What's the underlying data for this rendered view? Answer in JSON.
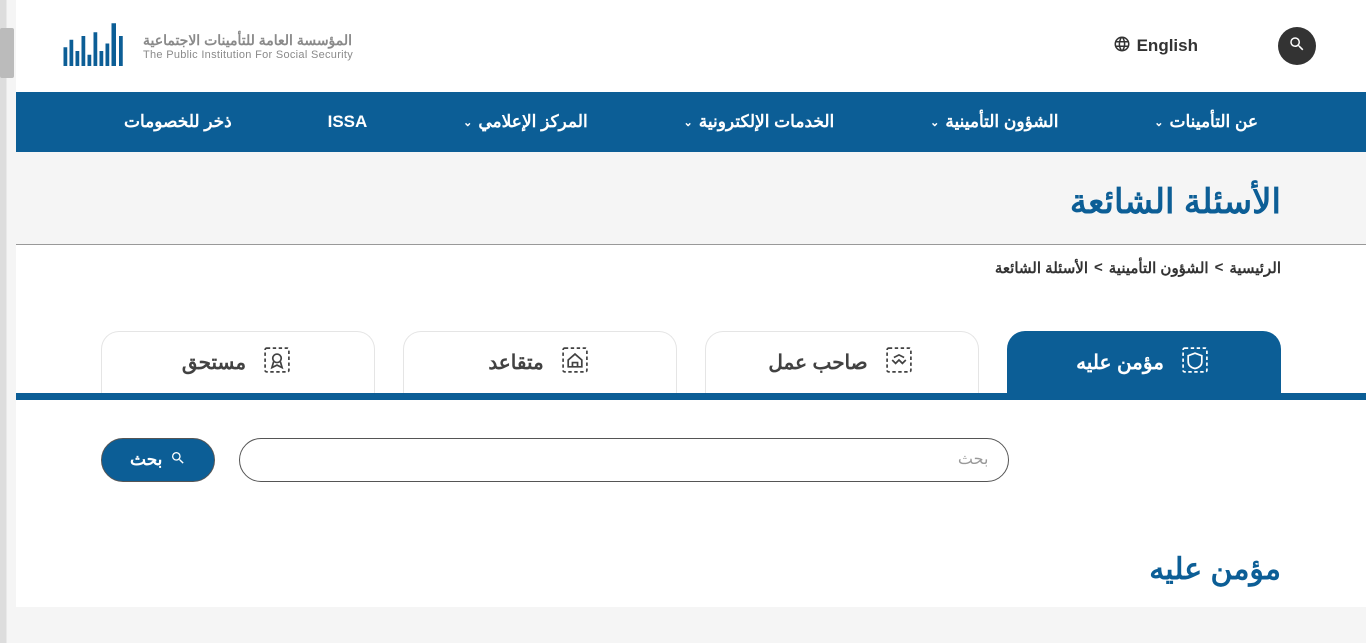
{
  "header": {
    "lang_label": "English",
    "logo_ar": "المؤسسة العامة للتأمينات الاجتماعية",
    "logo_en": "The Public Institution For Social Security"
  },
  "nav": {
    "items": [
      {
        "label": "عن التأمينات",
        "dropdown": true
      },
      {
        "label": "الشؤون التأمينية",
        "dropdown": true
      },
      {
        "label": "الخدمات الإلكترونية",
        "dropdown": true
      },
      {
        "label": "المركز الإعلامي",
        "dropdown": true
      },
      {
        "label": "ISSA",
        "dropdown": false
      },
      {
        "label": "ذخر للخصومات",
        "dropdown": false
      }
    ]
  },
  "page": {
    "title": "الأسئلة الشائعة"
  },
  "breadcrumb": {
    "items": [
      {
        "label": "الرئيسية"
      },
      {
        "label": "الشؤون التأمينية"
      },
      {
        "label": "الأسئلة الشائعة"
      }
    ],
    "sep": ">"
  },
  "tabs": {
    "items": [
      {
        "label": "مؤمن عليه",
        "active": true
      },
      {
        "label": "صاحب عمل",
        "active": false
      },
      {
        "label": "متقاعد",
        "active": false
      },
      {
        "label": "مستحق",
        "active": false
      }
    ]
  },
  "search": {
    "placeholder": "بحث",
    "button": "بحث"
  },
  "section": {
    "title": "مؤمن عليه"
  }
}
